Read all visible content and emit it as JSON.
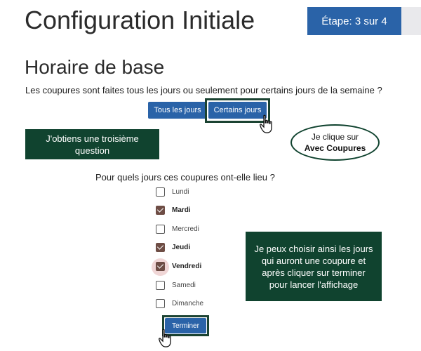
{
  "header": {
    "title": "Configuration Initiale",
    "step": "Étape: 3 sur 4"
  },
  "section": {
    "title": "Horaire de base",
    "question1": "Les coupures sont faites tous les jours ou seulement pour certains jours de la semaine ?",
    "options": {
      "tous": "Tous les jours",
      "certains": "Certains jours"
    },
    "question2": "Pour quels jours ces coupures ont-elle lieu ?",
    "days": [
      {
        "label": "Lundi",
        "checked": false
      },
      {
        "label": "Mardi",
        "checked": true
      },
      {
        "label": "Mercredi",
        "checked": false
      },
      {
        "label": "Jeudi",
        "checked": true
      },
      {
        "label": "Vendredi",
        "checked": true
      },
      {
        "label": "Samedi",
        "checked": false
      },
      {
        "label": "Dimanche",
        "checked": false
      }
    ],
    "finish": "Terminer"
  },
  "annotations": {
    "note1": "J'obtiens une troisième question",
    "bubble_line1": "Je clique sur",
    "bubble_line2": "Avec Coupures",
    "note2": "Je peux choisir ainsi les jours qui auront une coupure et après cliquer sur terminer pour lancer l'affichage"
  },
  "colors": {
    "primary": "#2a63a8",
    "annotation": "#10432f",
    "checked": "#6e4d45"
  }
}
